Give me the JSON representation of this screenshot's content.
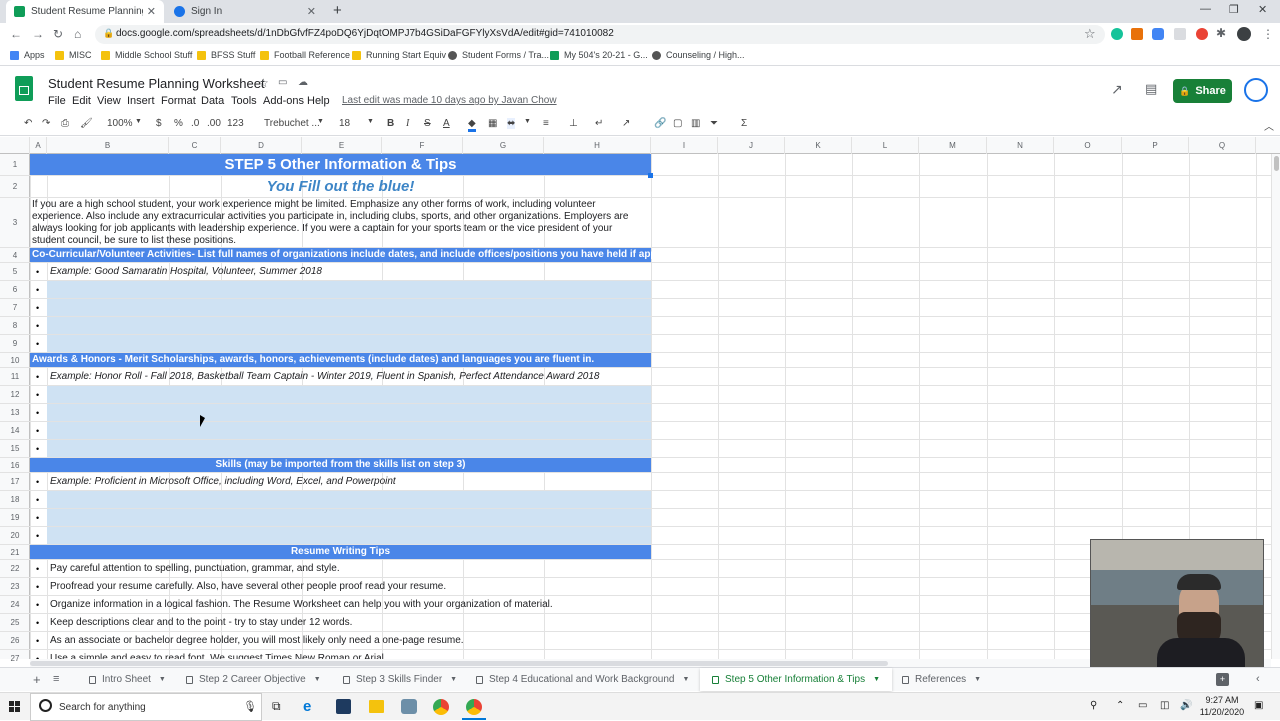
{
  "browser": {
    "tabs": [
      {
        "title": "Student Resume Planning Worksh",
        "active": true,
        "favicon_color": "#0f9d58"
      },
      {
        "title": "Sign In",
        "active": false,
        "favicon_color": "#1a73e8"
      }
    ],
    "url": "docs.google.com/spreadsheets/d/1nDbGfvfFZ4poDQ6YjDqtOMPJ7b4GSiDaFGFYlyXsVdA/edit#gid=741010082",
    "bookmarks": [
      "Apps",
      "MISC",
      "Middle School Stuff",
      "BFSS Stuff",
      "Football Reference",
      "Running Start Equiv",
      "Student Forms / Tra...",
      "My 504's 20-21 - G...",
      "Counseling / High..."
    ]
  },
  "sheets": {
    "title": "Student Resume Planning Worksheet",
    "menu": [
      "File",
      "Edit",
      "View",
      "Insert",
      "Format",
      "Data",
      "Tools",
      "Add-ons",
      "Help"
    ],
    "last_edit": "Last edit was made 10 days ago by Javan Chow",
    "share_label": "Share",
    "toolbar": {
      "zoom": "100%",
      "currency": "$",
      "percent": "%",
      "dec_less": ".0",
      "dec_more": ".00",
      "format": "123",
      "font": "Trebuchet ...",
      "size": "18",
      "bold": "B",
      "italic": "I",
      "strike": "S",
      "textcolor": "A"
    },
    "columns": [
      "A",
      "B",
      "C",
      "D",
      "E",
      "F",
      "G",
      "H",
      "I",
      "J",
      "K",
      "L",
      "M",
      "N",
      "O",
      "P",
      "Q"
    ],
    "rows": [
      "1",
      "2",
      "3",
      "4",
      "5",
      "6",
      "7",
      "8",
      "9",
      "10",
      "11",
      "12",
      "13",
      "14",
      "15",
      "16",
      "17",
      "18",
      "19",
      "20",
      "21",
      "22",
      "23",
      "24",
      "25",
      "26",
      "27"
    ],
    "cells": {
      "r1": "STEP 5 Other Information & Tips",
      "r2": "You Fill out the blue!",
      "r3_l1": "If you are a high school student, your work experience might be limited. Emphasize any other forms of work, including volunteer",
      "r3_l2": "experience. Also include any extracurricular activities you participate in, including clubs, sports, and other organizations. Employers are",
      "r3_l3": "always looking for job applicants with leadership experience. If you were a captain for your sports team or the vice president of your",
      "r3_l4": "student council, be sure to list these positions.",
      "r4": "Co-Curricular/Volunteer Activities- List full names of organizations include dates, and include offices/positions you have held if applicable",
      "r5": "Example: Good Samaratin Hospital, Volunteer, Summer 2018",
      "r10": "Awards & Honors - Merit Scholarships, awards, honors, achievements (include dates) and languages you are fluent in.",
      "r11": "Example: Honor Roll - Fall 2018, Basketball Team Captain - Winter 2019, Fluent in Spanish, Perfect Attendance Award 2018",
      "r16": "Skills (may be imported from the skills list on step 3)",
      "r17": "Example: Proficient in Microsoft Office, including Word, Excel, and Powerpoint",
      "r21": "Resume Writing Tips",
      "r22": "Pay careful attention to spelling, punctuation, grammar, and style.",
      "r23": "Proofread your resume carefully. Also, have several other people proof read your resume.",
      "r24": "Organize information in a logical fashion. The Resume Worksheet can help you with your organization of material.",
      "r25": "Keep descriptions clear and to the point - try to stay under 12 words.",
      "r26": "As an associate or bachelor degree holder, you will most likely only need a one-page resume.",
      "r27": "Use a simple and easy to read font. We suggest Times New Roman or Arial."
    },
    "sheet_tabs": [
      "Intro Sheet",
      "Step 2 Career Objective",
      "Step 3 Skills Finder",
      "Step 4 Educational and Work Background",
      "Step 5 Other Information & Tips",
      "References"
    ],
    "active_sheet": "Step 5 Other Information & Tips",
    "colors": {
      "header_blue": "#4a86e8",
      "fill_blue": "#cfe2f3",
      "title_blue": "#3d85c6",
      "share_green": "#188038"
    }
  },
  "taskbar": {
    "search_placeholder": "Search for anything",
    "time": "9:27 AM",
    "date": "11/20/2020"
  }
}
